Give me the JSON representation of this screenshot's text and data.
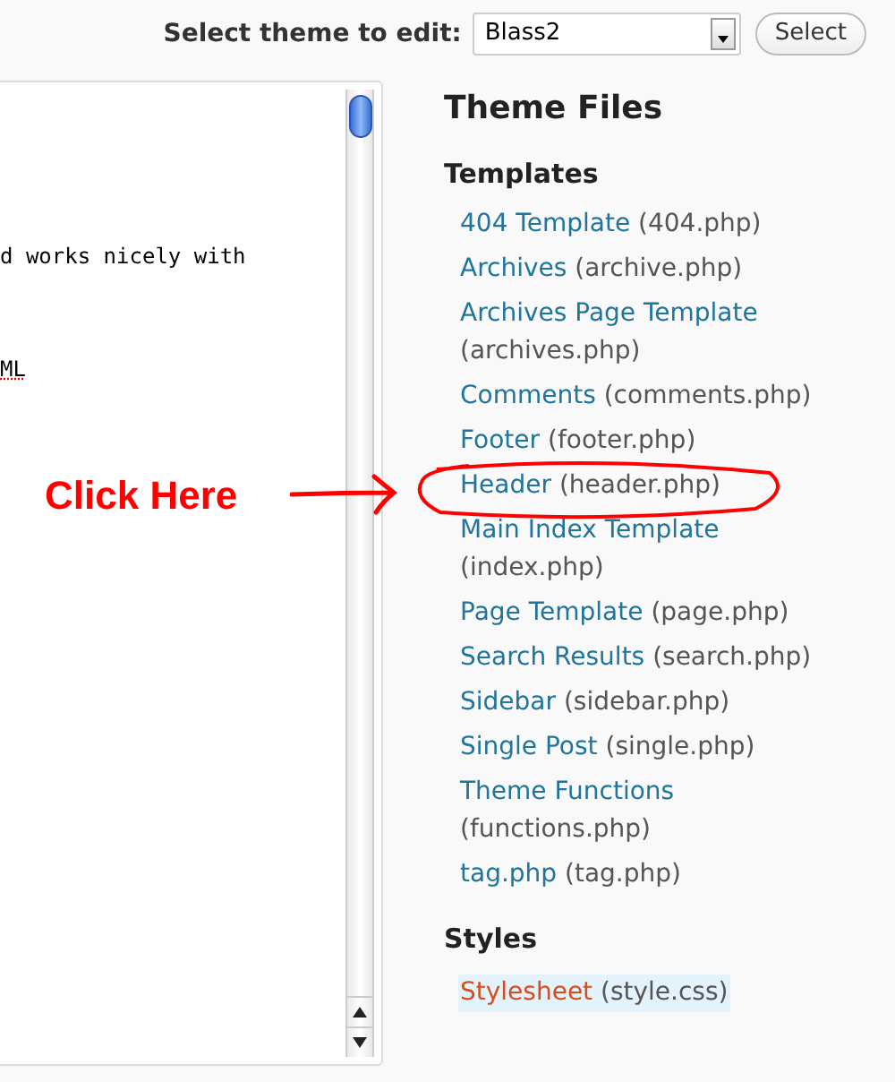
{
  "theme_select": {
    "label": "Select theme to edit:",
    "value": "Blass2",
    "button": "Select"
  },
  "editor": {
    "lines": [
      {
        "text": "d works nicely with",
        "misspelled": false
      },
      {
        "text": "ML",
        "misspelled": true
      }
    ]
  },
  "annotation": {
    "text": "Click Here"
  },
  "theme_files": {
    "title": "Theme Files",
    "sections": [
      {
        "title": "Templates",
        "items": [
          {
            "name": "404 Template",
            "file": "(404.php)",
            "selected": false
          },
          {
            "name": "Archives",
            "file": "(archive.php)",
            "selected": false
          },
          {
            "name": "Archives Page Template",
            "file": "(archives.php)",
            "selected": false
          },
          {
            "name": "Comments",
            "file": "(comments.php)",
            "selected": false
          },
          {
            "name": "Footer",
            "file": "(footer.php)",
            "selected": false
          },
          {
            "name": "Header",
            "file": "(header.php)",
            "selected": false
          },
          {
            "name": "Main Index Template",
            "file": "(index.php)",
            "selected": false
          },
          {
            "name": "Page Template",
            "file": "(page.php)",
            "selected": false
          },
          {
            "name": "Search Results",
            "file": "(search.php)",
            "selected": false
          },
          {
            "name": "Sidebar",
            "file": "(sidebar.php)",
            "selected": false
          },
          {
            "name": "Single Post",
            "file": "(single.php)",
            "selected": false
          },
          {
            "name": "Theme Functions",
            "file": "(functions.php)",
            "selected": false
          },
          {
            "name": "tag.php",
            "file": "(tag.php)",
            "selected": false
          }
        ]
      },
      {
        "title": "Styles",
        "items": [
          {
            "name": "Stylesheet",
            "file": "(style.css)",
            "selected": true
          }
        ]
      }
    ]
  }
}
